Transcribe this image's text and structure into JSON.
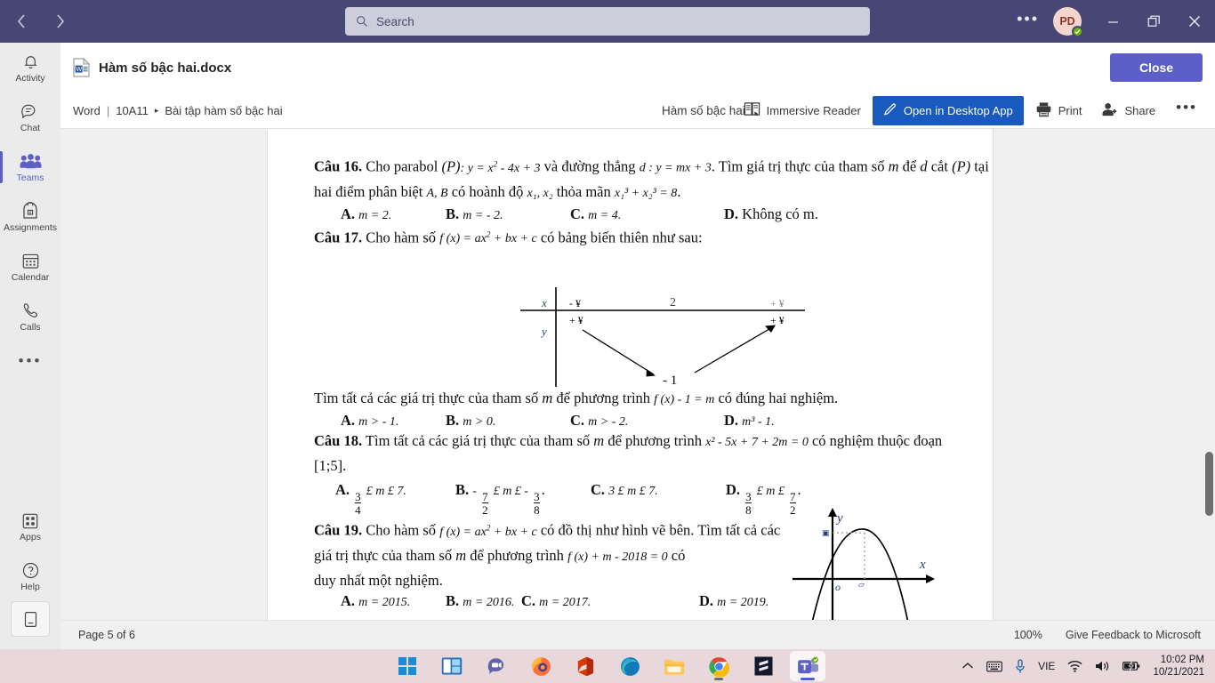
{
  "titlebar": {
    "back_icon": "chevron-left-icon",
    "forward_icon": "chevron-right-icon",
    "search_placeholder": "Search",
    "more_label": "•••",
    "avatar_initials": "PD",
    "minimize_label": "—",
    "restore_label": "❐",
    "close_label": "✕",
    "accent": "#464775",
    "search_bg": "#cdcddc"
  },
  "rail": {
    "items": [
      {
        "label": "Activity",
        "icon": "bell-icon",
        "active": false
      },
      {
        "label": "Chat",
        "icon": "chat-icon",
        "active": false
      },
      {
        "label": "Teams",
        "icon": "teams-people-icon",
        "active": true
      },
      {
        "label": "Assignments",
        "icon": "backpack-icon",
        "active": false
      },
      {
        "label": "Calendar",
        "icon": "calendar-icon",
        "active": false
      },
      {
        "label": "Calls",
        "icon": "phone-icon",
        "active": false
      }
    ],
    "more_label": "•••",
    "bottom_items": [
      {
        "label": "Apps",
        "icon": "apps-grid-icon"
      },
      {
        "label": "Help",
        "icon": "question-circle-icon"
      }
    ],
    "store_icon": "download-store-icon",
    "active_color": "#5b5fc7"
  },
  "doc_header": {
    "file_icon": "word-file-icon",
    "title": "Hàm số bậc hai.docx",
    "close_label": "Close"
  },
  "cmdbar": {
    "app_name": "Word",
    "separator": "|",
    "team": "10A11",
    "chevron": "▸",
    "channel": "Bài tập hàm số bậc hai",
    "center_title": "Hàm số bậc hai",
    "immersive_reader": {
      "label": "Immersive Reader",
      "icon": "immersive-reader-icon"
    },
    "open_desktop": {
      "label": "Open in Desktop App",
      "icon": "pencil-icon"
    },
    "print": {
      "label": "Print",
      "icon": "printer-icon"
    },
    "share": {
      "label": "Share",
      "icon": "share-person-icon"
    },
    "more_label": "•••",
    "primary_color": "#185abd"
  },
  "document": {
    "q16": {
      "number": "Câu 16.",
      "line1_a": "Cho parabol",
      "line1_p": "(P)",
      "line1_eq1": ": y = x",
      "line1_eq1_sup": "2",
      "line1_eq1_rest": " - 4x + 3",
      "line1_b": "và đường thẳng",
      "line1_eq2": "d : y = mx + 3",
      "line1_c": ". Tìm giá trị thực của tham số",
      "line1_m": "m",
      "line1_d": "để",
      "line1_d2": "d",
      "line1_e": "cắt",
      "line2_a": "(P)",
      "line2_b": "tại hai điểm phân biệt",
      "line2_ab": "A, B",
      "line2_c": "có hoành độ",
      "line2_x": "x₁, x₂",
      "line2_d": "thỏa mãn",
      "line2_eq": "x₁³ + x₂³ = 8",
      "line2_e": ".",
      "answers": [
        {
          "key": "A.",
          "text": "m = 2."
        },
        {
          "key": "B.",
          "text": "m = - 2."
        },
        {
          "key": "C.",
          "text": "m = 4."
        },
        {
          "key": "D.",
          "text": "Không có m."
        }
      ]
    },
    "q17": {
      "number": "Câu 17.",
      "line1_a": "Cho hàm số",
      "line1_f": "f (x) = ax",
      "line1_f_sup": "2",
      "line1_f_rest": " + bx + c",
      "line1_b": "có bảng biến thiên như sau:",
      "table": {
        "row_x_label": "x",
        "row_y_label": "y",
        "x_values": [
          "- ¥",
          "2",
          "+ ¥"
        ],
        "y_start": "+ ¥",
        "y_end": "+ ¥",
        "y_min": "- 1"
      },
      "prompt_a": "Tìm tất cả các giá trị thực của tham số",
      "prompt_m": "m",
      "prompt_b": "để phương trình",
      "prompt_eq": "f (x) - 1 = m",
      "prompt_c": "có đúng hai nghiệm.",
      "answers": [
        {
          "key": "A.",
          "text": "m > - 1."
        },
        {
          "key": "B.",
          "text": "m > 0."
        },
        {
          "key": "C.",
          "text": "m > - 2."
        },
        {
          "key": "D.",
          "text": "m³ - 1."
        }
      ]
    },
    "q18": {
      "number": "Câu 18.",
      "line1_a": "Tìm tất cả các giá trị thực của tham số",
      "line1_m": "m",
      "line1_b": "để phương trình",
      "line1_eq": "x² - 5x + 7 + 2m = 0",
      "line1_c": "có nghiệm thuộc đoạn",
      "line2": "[1;5].",
      "answers": [
        {
          "key": "A.",
          "num": "3",
          "den": "4",
          "mid": "£ m £ 7.",
          "lead": "",
          "tail_num": "",
          "tail_den": ""
        },
        {
          "key": "B.",
          "num": "7",
          "den": "2",
          "mid": "£ m £ -",
          "lead": "-",
          "tail_num": "3",
          "tail_den": "8"
        },
        {
          "key": "C.",
          "num": "",
          "den": "",
          "mid": "3 £ m £ 7.",
          "lead": "",
          "tail_num": "",
          "tail_den": ""
        },
        {
          "key": "D.",
          "num": "3",
          "den": "8",
          "mid": "£ m £",
          "lead": "",
          "tail_num": "7",
          "tail_den": "2"
        }
      ]
    },
    "q19": {
      "number": "Câu 19.",
      "line1_a": "Cho hàm số",
      "line1_f": "f (x) = ax",
      "line1_f_sup": "2",
      "line1_f_rest": " + bx + c",
      "line1_b": "có đồ thị như hình vẽ bên. Tìm tất",
      "line2_a": "cả các giá trị thực của tham số",
      "line2_m": "m",
      "line2_b": "để phương trình",
      "line2_eq": "f (x) + m - 2018 = 0",
      "line2_c": "có",
      "line3": "duy nhất một nghiệm.",
      "answers": [
        {
          "key": "A.",
          "text": "m = 2015."
        },
        {
          "key": "B.",
          "text": "m = 2016."
        },
        {
          "key": "C.",
          "text": "m = 2017."
        },
        {
          "key": "D.",
          "text": "m = 2019."
        }
      ],
      "figure": {
        "y_label": "y",
        "x_label": "x",
        "origin_label": "o",
        "y_marker": "□",
        "x_marker": "▱"
      }
    }
  },
  "statusbar": {
    "page_label": "Page 5 of 6",
    "zoom": "100%",
    "feedback": "Give Feedback to Microsoft"
  },
  "taskbar": {
    "apps": [
      {
        "name": "start-windows-icon",
        "running": false,
        "active": false
      },
      {
        "name": "task-view-icon",
        "running": false,
        "active": false
      },
      {
        "name": "chat-video-icon",
        "running": false,
        "active": false
      },
      {
        "name": "firefox-icon",
        "running": false,
        "active": false
      },
      {
        "name": "office-icon",
        "running": false,
        "active": false
      },
      {
        "name": "edge-icon",
        "running": false,
        "active": false
      },
      {
        "name": "file-explorer-icon",
        "running": false,
        "active": false
      },
      {
        "name": "chrome-icon",
        "running": true,
        "active": false
      },
      {
        "name": "sublime-icon",
        "running": false,
        "active": false
      },
      {
        "name": "teams-icon",
        "running": true,
        "active": true
      }
    ],
    "tray": {
      "chevron_up": "show-hidden-icons",
      "keyboard": "touch-keyboard-icon",
      "mic": "microphone-icon",
      "lang": "VIE",
      "wifi": "wifi-icon",
      "volume": "speaker-icon",
      "battery": "battery-charging-icon",
      "time": "10:02 PM",
      "date": "10/21/2021"
    }
  }
}
